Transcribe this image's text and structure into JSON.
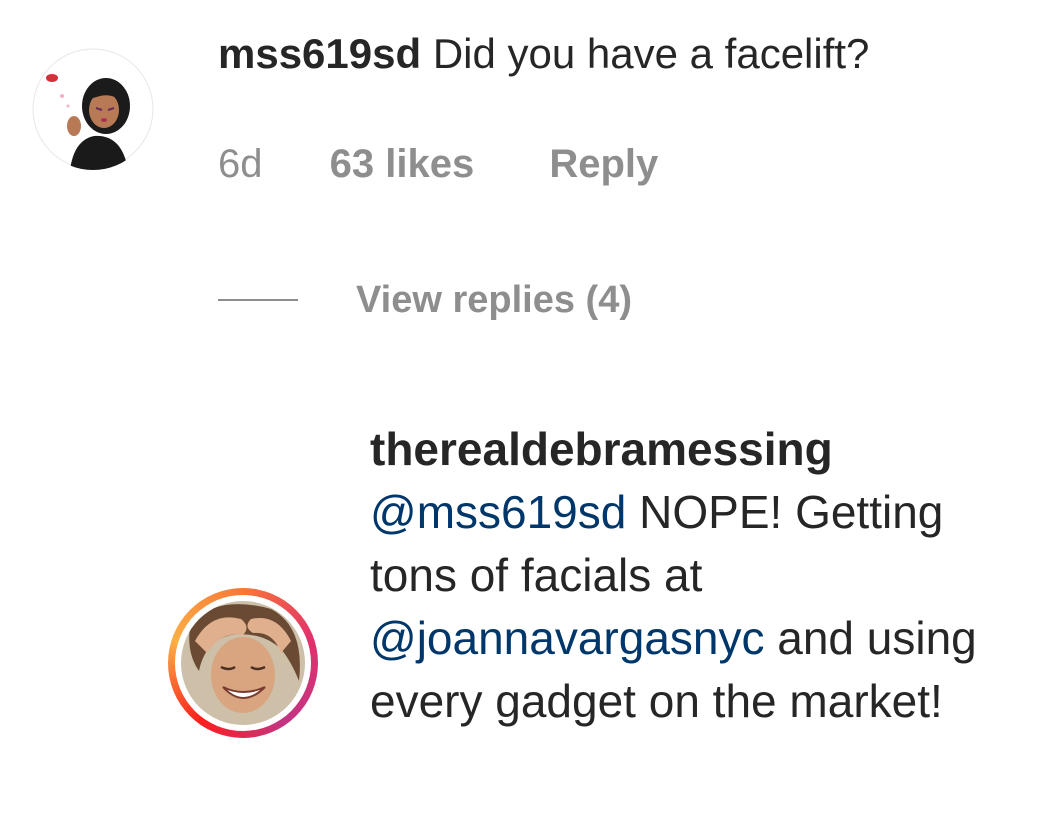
{
  "comment": {
    "username": "mss619sd",
    "text": "Did you have a facelift?",
    "time": "6d",
    "likes": "63 likes",
    "reply_label": "Reply",
    "view_replies_label": "View replies (4)"
  },
  "reply": {
    "username": "therealdebramessing",
    "mention1": "@mss619sd",
    "text1": " NOPE! Getting tons of facials at ",
    "mention2": "@joannavargasnyc",
    "text2": " and using every gadget on the market!"
  },
  "colors": {
    "text": "#262626",
    "secondary": "#8e8e8e",
    "mention": "#00376b",
    "story_ring": "#e1306c"
  },
  "icons": {
    "comment_avatar": "bitmoji-avatar",
    "reply_avatar": "profile-photo-avatar"
  }
}
